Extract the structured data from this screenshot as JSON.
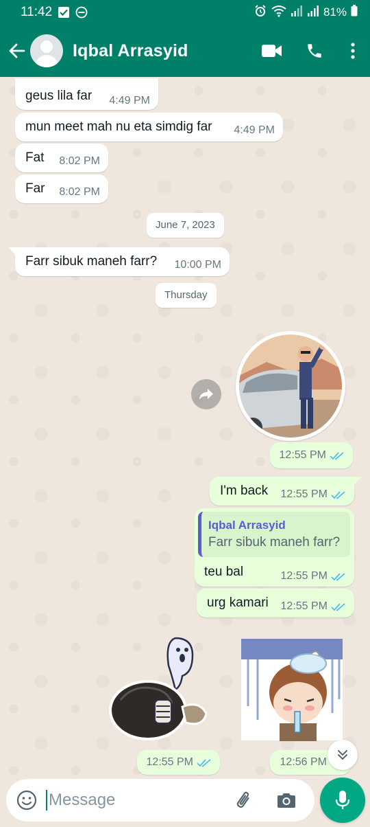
{
  "status_bar": {
    "time": "11:42",
    "battery": "81%"
  },
  "header": {
    "contact_name": "Iqbal Arrasyid"
  },
  "messages": [
    {
      "text": "geus lila far",
      "time": "4:49 PM"
    },
    {
      "text": "mun meet mah nu eta simdig far",
      "time": "4:49 PM"
    },
    {
      "text": "Fat",
      "time": "8:02 PM"
    },
    {
      "text": "Far",
      "time": "8:02 PM"
    },
    {
      "text": "Farr sibuk maneh farr?",
      "time": "10:00 PM"
    }
  ],
  "date_separators": [
    "June 7, 2023",
    "Thursday"
  ],
  "outgoing": [
    {
      "text": "",
      "time": "12:55 PM"
    },
    {
      "text": "I'm back",
      "time": "12:55 PM"
    },
    {
      "text": "teu bal",
      "time": "12:55 PM",
      "reply": {
        "name": "Iqbal Arrasyid",
        "text": "Farr sibuk maneh farr?"
      }
    },
    {
      "text": "urg kamari",
      "time": "12:55 PM"
    }
  ],
  "stickers": [
    {
      "time": "12:55 PM"
    },
    {
      "time": "12:56 PM"
    }
  ],
  "input": {
    "placeholder": "Message"
  },
  "colors": {
    "header": "#008069",
    "outgoing_bubble": "#e7ffdb",
    "tick_read": "#53bdeb",
    "fab": "#00a884"
  }
}
